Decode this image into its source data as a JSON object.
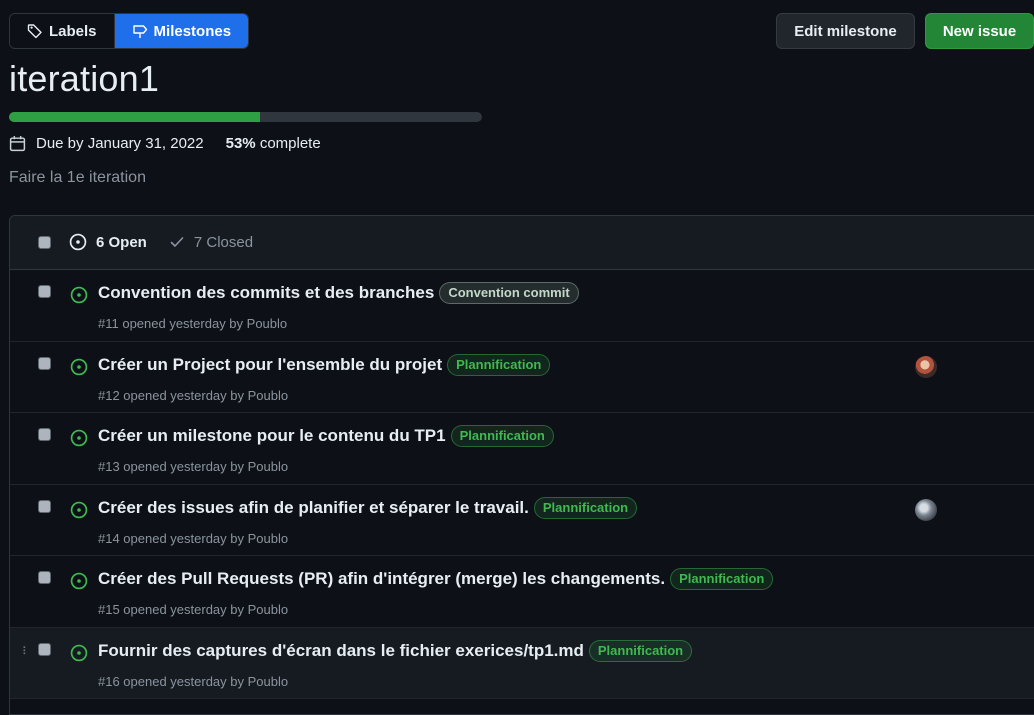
{
  "nav": {
    "labels_tab": "Labels",
    "milestones_tab": "Milestones",
    "edit_button": "Edit milestone",
    "new_issue_button": "New issue"
  },
  "milestone": {
    "title": "iteration1",
    "progress_percent": 53,
    "due_text": "Due by January 31, 2022",
    "percent_text": "53%",
    "complete_text": "complete",
    "description": "Faire la 1e iteration"
  },
  "issues_header": {
    "open_text": "6 Open",
    "closed_text": "7 Closed"
  },
  "issues": [
    {
      "title": "Convention des commits et des branches",
      "label": "Convention commit",
      "label_style": "grey",
      "meta": "#11 opened yesterday by Poublo",
      "assignee": false
    },
    {
      "title": "Créer un Project pour l'ensemble du projet",
      "label": "Plannification",
      "label_style": "green",
      "meta": "#12 opened yesterday by Poublo",
      "assignee": true
    },
    {
      "title": "Créer un milestone pour le contenu du TP1",
      "label": "Plannification",
      "label_style": "green",
      "meta": "#13 opened yesterday by Poublo",
      "assignee": false
    },
    {
      "title": "Créer des issues afin de planifier et séparer le travail.",
      "label": "Plannification",
      "label_style": "green",
      "meta": "#14 opened yesterday by Poublo",
      "assignee": true
    },
    {
      "title": "Créer des Pull Requests (PR) afin d'intégrer (merge) les changements.",
      "label": "Plannification",
      "label_style": "green",
      "meta": "#15 opened yesterday by Poublo",
      "assignee": false
    },
    {
      "title": "Fournir des captures d'écran dans le fichier exerices/tp1.md",
      "label": "Plannification",
      "label_style": "green",
      "meta": "#16 opened yesterday by Poublo",
      "assignee": false
    }
  ],
  "colors": {
    "accent_blue": "#1f6feb",
    "success_green": "#238636",
    "open_icon_green": "#3fb950",
    "background": "#0d1117"
  },
  "icons": [
    "tag-icon",
    "milestone-icon",
    "calendar-icon",
    "issue-opened-icon",
    "check-icon",
    "drag-handle-icon"
  ]
}
